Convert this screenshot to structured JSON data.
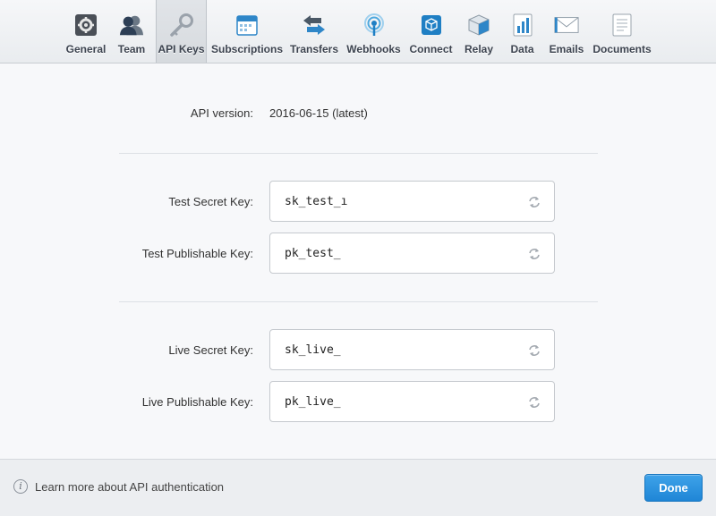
{
  "tabs": [
    {
      "label": "General",
      "icon": "gear-icon"
    },
    {
      "label": "Team",
      "icon": "team-icon"
    },
    {
      "label": "API Keys",
      "icon": "key-icon",
      "active": true
    },
    {
      "label": "Subscriptions",
      "icon": "calendar-icon"
    },
    {
      "label": "Transfers",
      "icon": "transfer-arrows-icon"
    },
    {
      "label": "Webhooks",
      "icon": "broadcast-icon"
    },
    {
      "label": "Connect",
      "icon": "cube-icon"
    },
    {
      "label": "Relay",
      "icon": "box-icon"
    },
    {
      "label": "Data",
      "icon": "data-chart-icon"
    },
    {
      "label": "Emails",
      "icon": "envelope-icon"
    },
    {
      "label": "Documents",
      "icon": "document-icon"
    }
  ],
  "api_version": {
    "label": "API version:",
    "value": "2016-06-15 (latest)"
  },
  "keys": [
    {
      "label": "Test Secret Key:",
      "value": "sk_test_ı"
    },
    {
      "label": "Test Publishable Key:",
      "value": "pk_test_"
    },
    {
      "label": "Live Secret Key:",
      "value": "sk_live_"
    },
    {
      "label": "Live Publishable Key:",
      "value": "pk_live_"
    }
  ],
  "footer": {
    "learn_more": "Learn more about API authentication",
    "done_label": "Done"
  },
  "colors": {
    "accent": "#1f86d6",
    "background": "#f7f8fa"
  }
}
